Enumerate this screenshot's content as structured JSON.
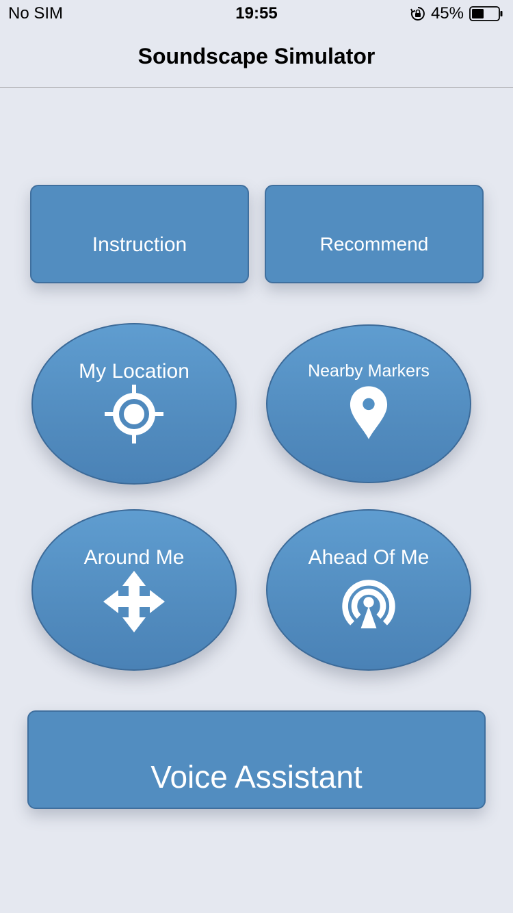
{
  "status_bar": {
    "carrier": "No SIM",
    "time": "19:55",
    "battery_percent": "45%",
    "battery_level": 0.45
  },
  "nav": {
    "title": "Soundscape Simulator"
  },
  "buttons": {
    "instruction": "Instruction",
    "recommend": "Recommend",
    "my_location": "My Location",
    "nearby_markers": "Nearby Markers",
    "around_me": "Around Me",
    "ahead_of_me": "Ahead Of Me",
    "voice_assistant": "Voice Assistant"
  },
  "icons": {
    "my_location": "crosshair-target-icon",
    "nearby_markers": "map-pin-icon",
    "around_me": "four-way-arrows-icon",
    "ahead_of_me": "broadcast-signal-icon",
    "orientation_lock": "orientation-lock-icon",
    "battery": "battery-icon"
  },
  "colors": {
    "background": "#e5e8f0",
    "button_fill": "#528dc0",
    "button_border": "#3f6f9e",
    "text_on_button": "#ffffff"
  }
}
